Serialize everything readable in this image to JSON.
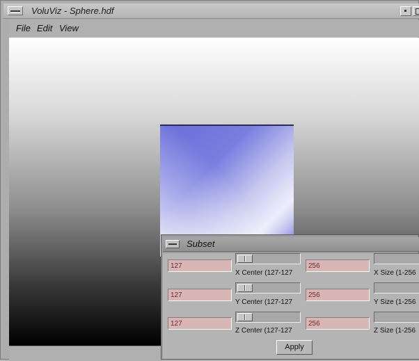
{
  "window": {
    "title": "VoluViz - Sphere.hdf"
  },
  "menubar": {
    "items": [
      {
        "label": "File"
      },
      {
        "label": "Edit"
      },
      {
        "label": "View"
      }
    ]
  },
  "viewport": {
    "background": "vertical gradient white to black",
    "cube_color": "#6a6ed8"
  },
  "dialog": {
    "title": "Subset",
    "rows": [
      {
        "center_value": "127",
        "center_label": "X Center (127-127",
        "size_value": "256",
        "size_label": "X Size (1-256"
      },
      {
        "center_value": "127",
        "center_label": "Y Center (127-127",
        "size_value": "256",
        "size_label": "Y Size (1-256"
      },
      {
        "center_value": "127",
        "center_label": "Z Center (127-127",
        "size_value": "256",
        "size_label": "Z Size (1-256"
      }
    ],
    "apply_label": "Apply"
  },
  "colors": {
    "field_bg": "#d9b6b6",
    "field_text": "#6b2a2a",
    "chrome": "#b0b0b0"
  }
}
